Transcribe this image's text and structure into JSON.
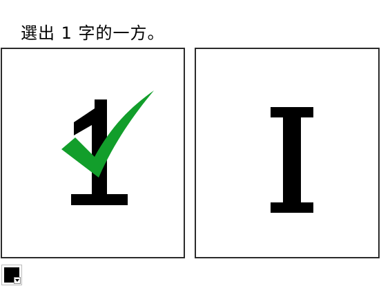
{
  "prompt": {
    "text": "選出 1 字的一方。"
  },
  "choices": [
    {
      "glyph": "digit-one",
      "selected": true,
      "correct_mark": "checkmark-icon"
    },
    {
      "glyph": "capital-i",
      "selected": false
    }
  ],
  "colors": {
    "check_green": "#129e2b",
    "glyph": "#000000",
    "border": "#2a2a2a",
    "swatch": "#000000"
  }
}
